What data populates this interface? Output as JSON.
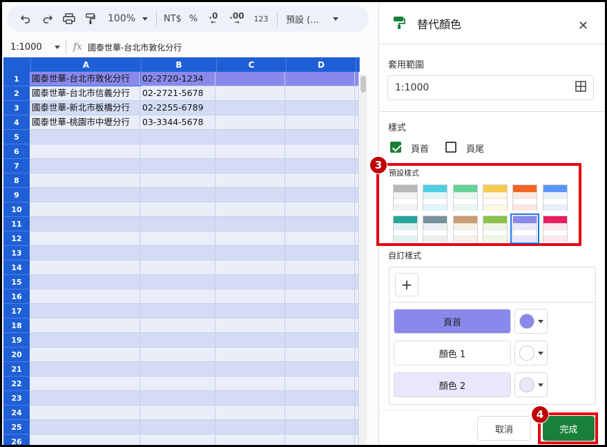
{
  "toolbar": {
    "zoom": "100%",
    "currency": "NT$",
    "percent": "%",
    "decimal_decrease": ".0",
    "decimal_increase": ".00",
    "number_format": "123",
    "font": "預設 (..."
  },
  "formula_bar": {
    "name_box": "1:1000",
    "fx": "fx",
    "content": "國泰世華-台北市敦化分行"
  },
  "grid": {
    "columns": [
      "A",
      "B",
      "C",
      "D"
    ],
    "rows": [
      "1",
      "2",
      "3",
      "4",
      "5",
      "6",
      "7",
      "8",
      "9",
      "10",
      "11",
      "12",
      "13",
      "14",
      "15",
      "16",
      "17",
      "18",
      "19",
      "20",
      "21",
      "22",
      "23",
      "24",
      "25",
      "26"
    ],
    "data": [
      [
        "國泰世華-台北市敦化分行",
        "02-2720-1234"
      ],
      [
        "國泰世華-台北市信義分行",
        "02-2721-5678"
      ],
      [
        "國泰世華-新北市板橋分行",
        "02-2255-6789"
      ],
      [
        "國泰世華-桃園市中壢分行",
        "03-3344-5678"
      ]
    ]
  },
  "panel": {
    "title": "替代顏色",
    "range_label": "套用範圍",
    "range_value": "1:1000",
    "style_label": "樣式",
    "header_label": "頁首",
    "header_checked": true,
    "footer_label": "頁尾",
    "footer_checked": false,
    "preset_label": "預設樣式",
    "presets": [
      {
        "header": "#b7b7b7",
        "row": "#f3f3f3"
      },
      {
        "header": "#4dd0e1",
        "row": "#e0f7fa"
      },
      {
        "header": "#63d297",
        "row": "#e7f9ef"
      },
      {
        "header": "#f7cb4d",
        "row": "#fef8e3"
      },
      {
        "header": "#f46524",
        "row": "#ffe6dd"
      },
      {
        "header": "#5b95f9",
        "row": "#e8f0fe"
      },
      {
        "header": "#26a69a",
        "row": "#ddf2f0"
      },
      {
        "header": "#78909c",
        "row": "#ebeff1"
      },
      {
        "header": "#ca9c72",
        "row": "#f8efe7"
      },
      {
        "header": "#8bc34a",
        "row": "#eef7e3"
      },
      {
        "header": "#8989eb",
        "row": "#e8e7fc"
      },
      {
        "header": "#e91d63",
        "row": "#fde8ef"
      }
    ],
    "selected_preset": 10,
    "custom_label": "自訂樣式",
    "add_symbol": "+",
    "custom": [
      {
        "label": "頁首",
        "color": "#8989eb"
      },
      {
        "label": "顏色 1",
        "color": "#ffffff"
      },
      {
        "label": "顏色 2",
        "color": "#e8e7fc"
      }
    ],
    "cancel_label": "取消",
    "done_label": "完成"
  },
  "markers": [
    "3",
    "4"
  ],
  "colors": {
    "header_blue": "#1f5fd6",
    "row_header": "#8989eb",
    "row_light": "#e8e7fc",
    "highlight_red": "#e60012",
    "done_green": "#188038"
  }
}
